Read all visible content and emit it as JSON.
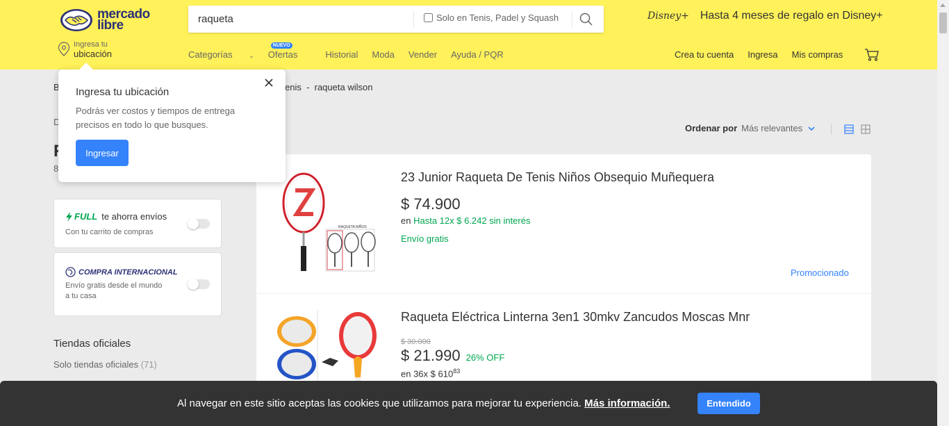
{
  "header": {
    "logo_line1": "mercado",
    "logo_line2": "libre",
    "search_value": "raqueta",
    "search_filter_label": "Solo en Tenis, Padel y Squash",
    "promo_text": "Hasta 4 meses de regalo en Disney+",
    "promo_brand": "Disney+",
    "location_line1": "Ingresa tu",
    "location_line2": "ubicación",
    "nav": {
      "categories": "Categorías",
      "offers": "Ofertas",
      "offers_badge": "NUEVO",
      "history": "Historial",
      "fashion": "Moda",
      "sell": "Vender",
      "help": "Ayuda / PQR"
    },
    "account": {
      "create": "Crea tu cuenta",
      "login": "Ingresa",
      "purchases": "Mis compras"
    }
  },
  "breadcrumb": {
    "left_fragment": "B",
    "trail": "enis  -  raqueta wilson"
  },
  "sidebar": {
    "fragment_d": "D",
    "fragment_r": "R",
    "fragment_count": "8",
    "full": {
      "badge": "FULL",
      "title": "te ahorra envíos",
      "subtitle": "Con tu carrito de compras"
    },
    "international": {
      "badge": "COMPRA INTERNACIONAL",
      "subtitle_line1": "Envío gratis desde el mundo",
      "subtitle_line2": "a tu casa"
    },
    "official_stores_heading": "Tiendas oficiales",
    "official_stores_link": "Solo tiendas oficiales",
    "official_stores_count": "(71)"
  },
  "sort": {
    "label": "Ordenar por",
    "value": "Más relevantes"
  },
  "results": [
    {
      "title": "23 Junior Raqueta De Tenis Niños Obsequio Muñequera",
      "price": "$ 74.900",
      "installments_prefix": "en",
      "installments": "Hasta 12x $ 6.242 sin interés",
      "shipping": "Envío gratis",
      "tag": "Promocionado",
      "image_label": "RAQUETA NIÑOS"
    },
    {
      "title": "Raqueta Eléctrica Linterna 3en1 30mkv Zancudos Moscas Mnr",
      "original_price": "$ 30.000",
      "price": "$ 21.990",
      "discount": "26% OFF",
      "installments_prefix": "en 36x $ 610",
      "installments_cents": "83"
    }
  ],
  "popover": {
    "title": "Ingresa tu ubicación",
    "text": "Podrás ver costos y tiempos de entrega precisos en todo lo que busques.",
    "button": "Ingresar"
  },
  "cookie": {
    "text": "Al navegar en este sitio aceptas las cookies que utilizamos para mejorar tu experiencia.",
    "link": "Más información.",
    "button": "Entendido"
  },
  "colors": {
    "header_bg": "#fff159",
    "accent_blue": "#3483fa",
    "green": "#00a650",
    "brand_navy": "#2d3277"
  }
}
